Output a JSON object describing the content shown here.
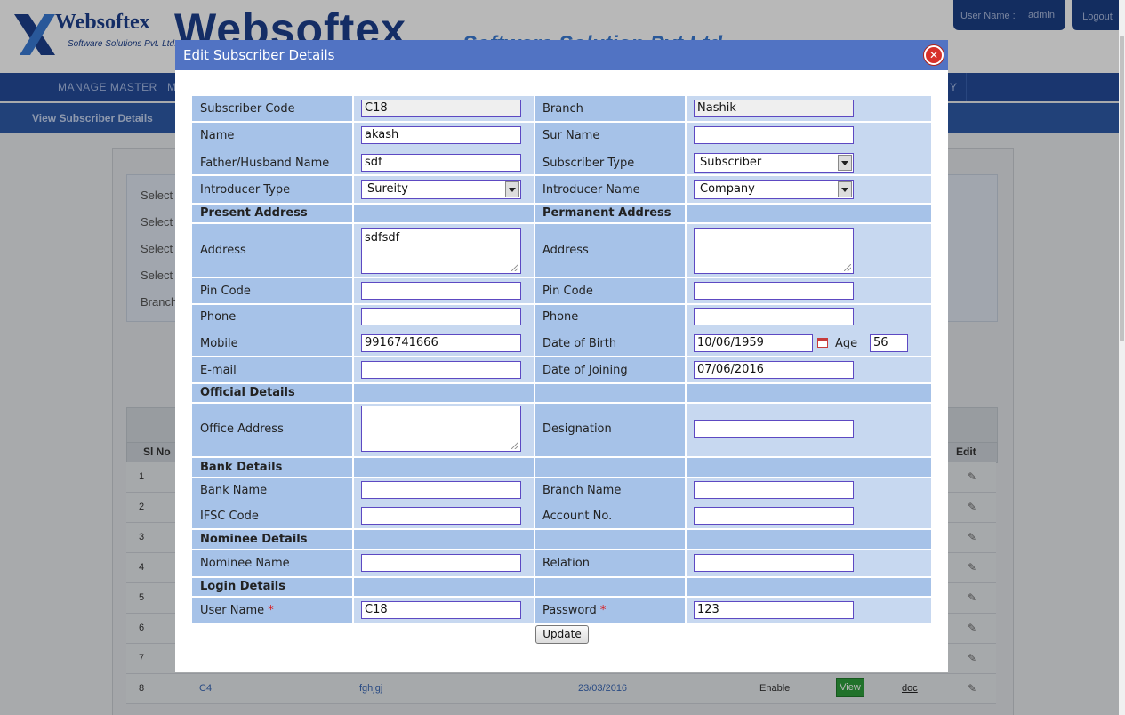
{
  "bg": {
    "logo_text": "Websoftex",
    "logo_sub": "Software Solutions Pvt. Ltd.",
    "logo_big": "Websoftex",
    "logo_big_tag": "Software Solution Pvt Ltd",
    "user_label": "User Name :",
    "user_value": "admin",
    "logout": "Logout",
    "nav": [
      "MANAGE MASTER",
      "M",
      "Y"
    ],
    "sub_title": "View Subscriber Details",
    "filters": [
      "Select",
      "Select",
      "Select",
      "Select",
      "Branch"
    ],
    "table_headers": {
      "sl": "Sl No",
      "edit": "Edit"
    },
    "rows": [
      {
        "num": "1"
      },
      {
        "num": "2"
      },
      {
        "num": "3"
      },
      {
        "num": "4"
      },
      {
        "num": "5"
      },
      {
        "num": "6"
      },
      {
        "num": "7"
      },
      {
        "num": "8",
        "code": "C4",
        "name": "fghjgj",
        "date": "23/03/2016",
        "status": "Enable",
        "view": "View",
        "doc": "doc"
      }
    ]
  },
  "modal": {
    "title": "Edit Subscriber Details",
    "close": "✕",
    "fields": {
      "subscriber_code": {
        "label": "Subscriber Code",
        "value": "C18"
      },
      "branch": {
        "label": "Branch",
        "value": "Nashik"
      },
      "name": {
        "label": "Name",
        "value": "akash"
      },
      "sur_name": {
        "label": "Sur Name",
        "value": ""
      },
      "father_name": {
        "label": "Father/Husband Name",
        "value": "sdf"
      },
      "subscriber_type": {
        "label": "Subscriber Type",
        "value": "Subscriber"
      },
      "introducer_type": {
        "label": "Introducer Type",
        "value": "Sureity"
      },
      "introducer_name": {
        "label": "Introducer Name",
        "value": "Company"
      },
      "present_address_section": "Present Address",
      "permanent_address_section": "Permanent Address",
      "address": {
        "label": "Address",
        "value": "sdfsdf"
      },
      "perm_address": {
        "label": "Address",
        "value": ""
      },
      "pin_code": {
        "label": "Pin Code",
        "value": ""
      },
      "perm_pin_code": {
        "label": "Pin Code",
        "value": ""
      },
      "phone": {
        "label": "Phone",
        "value": ""
      },
      "perm_phone": {
        "label": "Phone",
        "value": ""
      },
      "mobile": {
        "label": "Mobile",
        "value": "9916741666"
      },
      "dob": {
        "label": "Date of Birth",
        "value": "10/06/1959"
      },
      "age": {
        "label": "Age",
        "value": "56"
      },
      "email": {
        "label": "E-mail",
        "value": ""
      },
      "doj": {
        "label": "Date of Joining",
        "value": "07/06/2016"
      },
      "official_section": "Official Details",
      "office_address": {
        "label": "Office Address",
        "value": ""
      },
      "designation": {
        "label": "Designation",
        "value": ""
      },
      "bank_section": "Bank Details",
      "bank_name": {
        "label": "Bank Name",
        "value": ""
      },
      "branch_name": {
        "label": "Branch Name",
        "value": ""
      },
      "ifsc": {
        "label": "IFSC Code",
        "value": ""
      },
      "account_no": {
        "label": "Account No.",
        "value": ""
      },
      "nominee_section": "Nominee Details",
      "nominee_name": {
        "label": "Nominee Name",
        "value": ""
      },
      "relation": {
        "label": "Relation",
        "value": ""
      },
      "login_section": "Login Details",
      "user_name": {
        "label": "User Name",
        "value": "C18"
      },
      "password": {
        "label": "Password",
        "value": "123"
      },
      "required_mark": "*"
    },
    "update": "Update"
  }
}
